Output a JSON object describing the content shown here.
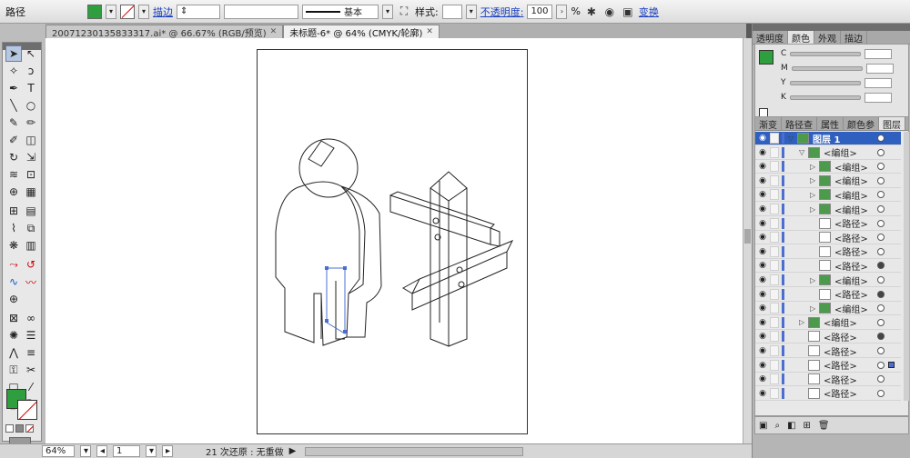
{
  "control_bar": {
    "object_type": "路径",
    "fill_color": "#2e9e3e",
    "stroke_label": "描边",
    "stroke_weight": "",
    "profile_label": "基本",
    "style_label": "样式:",
    "opacity_label": "不透明度:",
    "opacity_value": "100",
    "opacity_unit": "%",
    "transform_label": "变换"
  },
  "documents": {
    "tabs": [
      {
        "label": "20071230135833317.ai* @ 66.67% (RGB/预览)",
        "close": "✕"
      },
      {
        "label": "未标题-6* @ 64% (CMYK/轮廓)",
        "close": "✕"
      }
    ]
  },
  "status_bar": {
    "zoom": "64%",
    "page": "1",
    "info": "21 次还原 : 无重做"
  },
  "color_panel": {
    "tabs": [
      "透明度",
      "颜色",
      "外观",
      "描边"
    ],
    "active_tab": "颜色",
    "channels": [
      "C",
      "M",
      "Y",
      "K"
    ],
    "fill_color": "#2e9e3e"
  },
  "layers_panel": {
    "tabs": [
      "渐变",
      "路径查",
      "属性",
      "颜色参",
      "图层"
    ],
    "active_tab": "图层",
    "rows": [
      {
        "name": "图层 1",
        "kind": "layer",
        "indent": 0,
        "expanded": true
      },
      {
        "name": "<编组>",
        "kind": "group",
        "indent": 1,
        "expanded": true
      },
      {
        "name": "<编组>",
        "kind": "group",
        "indent": 2,
        "expanded": false
      },
      {
        "name": "<编组>",
        "kind": "group",
        "indent": 2,
        "expanded": false
      },
      {
        "name": "<编组>",
        "kind": "group",
        "indent": 2,
        "expanded": false
      },
      {
        "name": "<编组>",
        "kind": "group",
        "indent": 2,
        "expanded": false
      },
      {
        "name": "<路径>",
        "kind": "path",
        "indent": 2
      },
      {
        "name": "<路径>",
        "kind": "path",
        "indent": 2
      },
      {
        "name": "<路径>",
        "kind": "path",
        "indent": 2
      },
      {
        "name": "<路径>",
        "kind": "path",
        "indent": 2,
        "filled_target": true
      },
      {
        "name": "<编组>",
        "kind": "group",
        "indent": 2,
        "expanded": false
      },
      {
        "name": "<路径>",
        "kind": "path",
        "indent": 2,
        "filled_target": true
      },
      {
        "name": "<编组>",
        "kind": "group",
        "indent": 2,
        "expanded": false
      },
      {
        "name": "<编组>",
        "kind": "group",
        "indent": 1,
        "expanded": false
      },
      {
        "name": "<路径>",
        "kind": "path",
        "indent": 1,
        "filled_target": true
      },
      {
        "name": "<路径>",
        "kind": "path",
        "indent": 1
      },
      {
        "name": "<路径>",
        "kind": "path",
        "indent": 1,
        "selected": true
      },
      {
        "name": "<路径>",
        "kind": "path",
        "indent": 1
      },
      {
        "name": "<路径>",
        "kind": "path",
        "indent": 1
      }
    ]
  },
  "tools": {
    "selection": "selection-tool",
    "fill_swatch": "#2e9e3e"
  }
}
